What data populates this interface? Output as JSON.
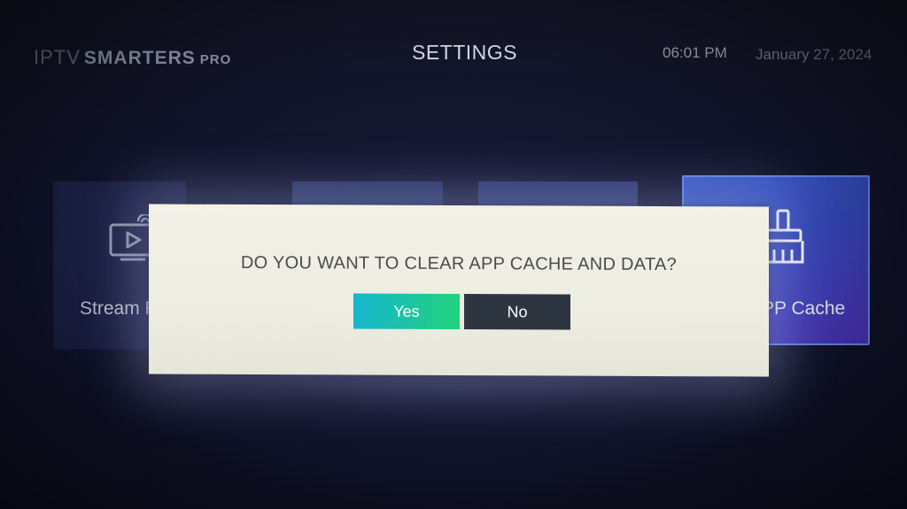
{
  "header": {
    "logo": {
      "part1": "IPTV",
      "part2": "SMARTERS",
      "part3": "PRO"
    },
    "title": "SETTINGS",
    "time": "06:01 PM",
    "date": "January 27, 2024"
  },
  "tiles": {
    "stream": {
      "label": "Stream F",
      "icon": "tv-signal-icon"
    },
    "cache": {
      "label": "PP Cache",
      "icon": "broom-icon"
    }
  },
  "dialog": {
    "message": "DO YOU WANT TO CLEAR APP CACHE AND DATA?",
    "yes_label": "Yes",
    "no_label": "No"
  },
  "colors": {
    "yes_button": "#1dc5a0",
    "no_button": "#2d3640",
    "dialog_bg": "#f0efe4",
    "cache_tile": "#3a4fc0"
  }
}
